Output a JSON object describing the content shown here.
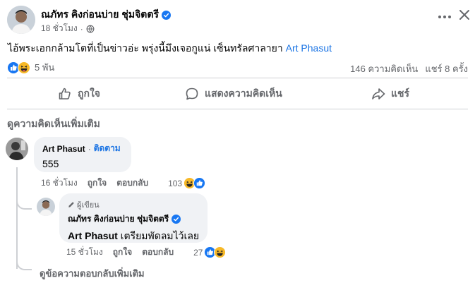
{
  "post": {
    "author_name": "ณภัทร คิงก่อนบ่าย ชุ่มจิตตรี",
    "time": "18 ชั่วโมง",
    "privacy_icon": "globe-icon",
    "text_before_mention": "ไอ้พระเอกกล้ามโตที่เป็นข่าวอ่ะ พรุ่งนี้มึงเจอกูแน่ เซ็นทรัลศาลายา ",
    "mention": "Art Phasut",
    "reactions_count": "5 พัน",
    "reaction_icons": [
      "like-icon",
      "haha-icon"
    ],
    "comments_count": "146 ความคิดเห็น",
    "shares_count": "แชร์ 8 ครั้ง"
  },
  "actions": {
    "like_label": "ถูกใจ",
    "comment_label": "แสดงความคิดเห็น",
    "share_label": "แชร์"
  },
  "more_comments_label": "ดูความคิดเห็นเพิ่มเติม",
  "comments": [
    {
      "author": "Art Phasut",
      "separator": "·",
      "follow_label": "ติดตาม",
      "text": "555",
      "time": "16 ชั่วโมง",
      "like_label": "ถูกใจ",
      "reply_label": "ตอบกลับ",
      "reaction_count": "103",
      "reaction_icons": [
        "haha-icon",
        "like-icon"
      ]
    }
  ],
  "reply": {
    "author_tag": "ผู้เขียน",
    "author": "ณภัทร คิงก่อนบ่าย ชุ่มจิตตรี",
    "mention": "Art Phasut",
    "text": " เตรียมพัดลมไว้เลย",
    "time": "15 ชั่วโมง",
    "like_label": "ถูกใจ",
    "reply_label": "ตอบกลับ",
    "reaction_count": "27",
    "reaction_icons": [
      "like-icon",
      "haha-icon"
    ]
  },
  "more_replies_label": "ดูข้อความตอบกลับเพิ่มเติม",
  "colors": {
    "accent": "#1b74e4",
    "like_blue": "#1877f2",
    "haha_yellow": "#f7b928",
    "muted": "#65676b",
    "bubble": "#f0f2f5"
  }
}
